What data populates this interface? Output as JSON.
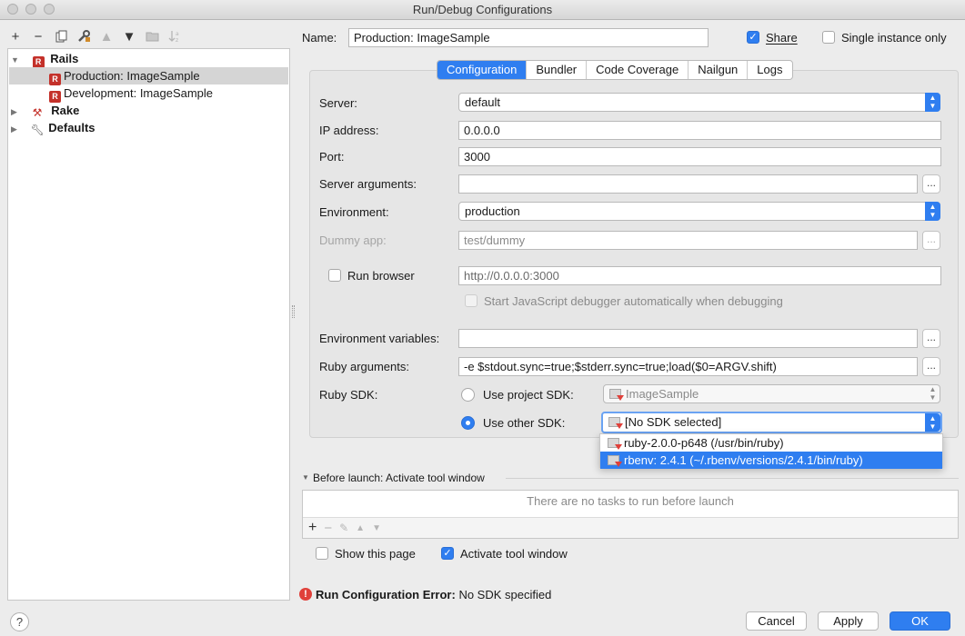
{
  "window": {
    "title": "Run/Debug Configurations"
  },
  "tree": {
    "rails_label": "Rails",
    "production_label": "Production: ImageSample",
    "development_label": "Development: ImageSample",
    "rake_label": "Rake",
    "defaults_label": "Defaults"
  },
  "header": {
    "name_label": "Name:",
    "name_value": "Production: ImageSample",
    "share_label": "Share",
    "single_instance_label": "Single instance only"
  },
  "tabs": [
    "Configuration",
    "Bundler",
    "Code Coverage",
    "Nailgun",
    "Logs"
  ],
  "form": {
    "server_label": "Server:",
    "server_value": "default",
    "ip_label": "IP address:",
    "ip_value": "0.0.0.0",
    "port_label": "Port:",
    "port_value": "3000",
    "server_args_label": "Server arguments:",
    "server_args_value": "",
    "environment_label": "Environment:",
    "environment_value": "production",
    "dummy_app_label": "Dummy app:",
    "dummy_app_placeholder": "test/dummy",
    "run_browser_label": "Run browser",
    "run_browser_url": "http://0.0.0.0:3000",
    "js_debugger_label": "Start JavaScript debugger automatically when debugging",
    "env_vars_label": "Environment variables:",
    "env_vars_value": "",
    "ruby_args_label": "Ruby arguments:",
    "ruby_args_value": "-e $stdout.sync=true;$stderr.sync=true;load($0=ARGV.shift)",
    "ruby_sdk_label": "Ruby SDK:",
    "use_project_sdk_label": "Use project SDK:",
    "project_sdk_value": "ImageSample",
    "use_other_sdk_label": "Use other SDK:",
    "other_sdk_value": "[No SDK selected]",
    "more_button": "..."
  },
  "sdk_popup": {
    "items": [
      "ruby-2.0.0-p648 (/usr/bin/ruby)",
      "rbenv: 2.4.1 (~/.rbenv/versions/2.4.1/bin/ruby)"
    ]
  },
  "before_launch": {
    "title": "Before launch: Activate tool window",
    "empty_text": "There are no tasks to run before launch",
    "show_page_label": "Show this page",
    "activate_tool_window_label": "Activate tool window"
  },
  "error": {
    "bold_text": "Run Configuration Error:",
    "message": "No SDK specified"
  },
  "footer": {
    "help": "?",
    "cancel": "Cancel",
    "apply": "Apply",
    "ok": "OK"
  },
  "colors": {
    "accent": "#2f7ef0",
    "error": "#e0403a"
  }
}
